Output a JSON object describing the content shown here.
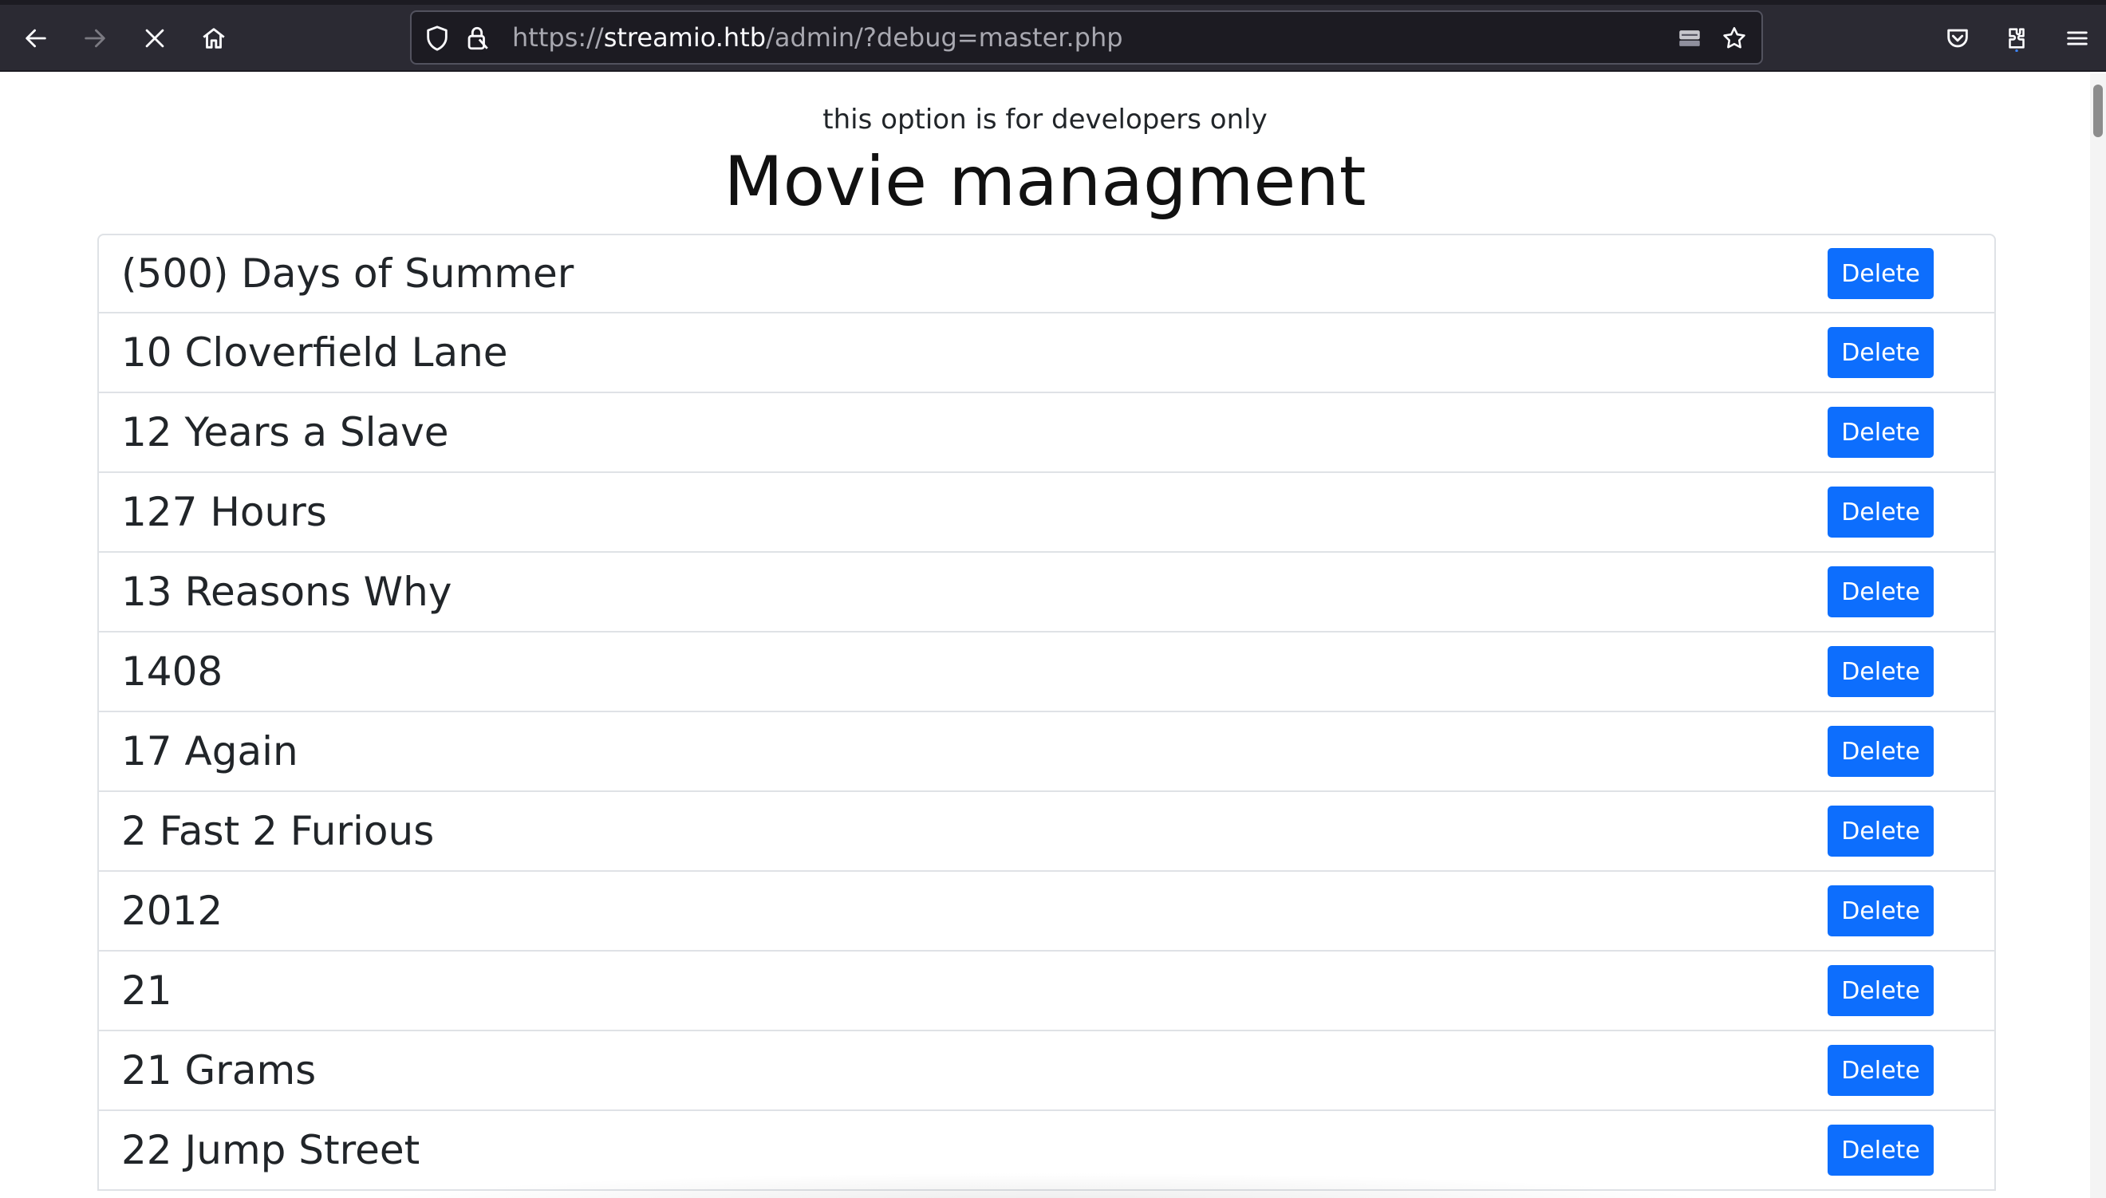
{
  "browser": {
    "url": {
      "scheme": "https://",
      "host": "streamio.htb",
      "path": "/admin/?debug=master.php"
    },
    "icons": {
      "back": "back-arrow-icon",
      "forward": "forward-arrow-icon",
      "stop": "stop-loading-icon",
      "home": "home-icon",
      "shield": "tracking-protection-shield-icon",
      "lock": "insecure-lock-icon",
      "reader": "reader-view-icon",
      "bookmark": "bookmark-star-icon",
      "pocket": "pocket-icon",
      "extensions": "extensions-icon",
      "menu": "hamburger-menu-icon"
    }
  },
  "page": {
    "dev_note": "this option is for developers only",
    "title": "Movie managment",
    "delete_label": "Delete",
    "movies": [
      "(500) Days of Summer",
      "10 Cloverfield Lane",
      "12 Years a Slave",
      "127 Hours",
      "13 Reasons Why",
      "1408",
      "17 Again",
      "2 Fast 2 Furious",
      "2012",
      "21",
      "21 Grams",
      "22 Jump Street"
    ]
  },
  "colors": {
    "chrome_bg": "#2b2a33",
    "urlbar_bg": "#1c1b22",
    "button_primary": "#0d6efd",
    "list_border": "#dfe2e6"
  }
}
